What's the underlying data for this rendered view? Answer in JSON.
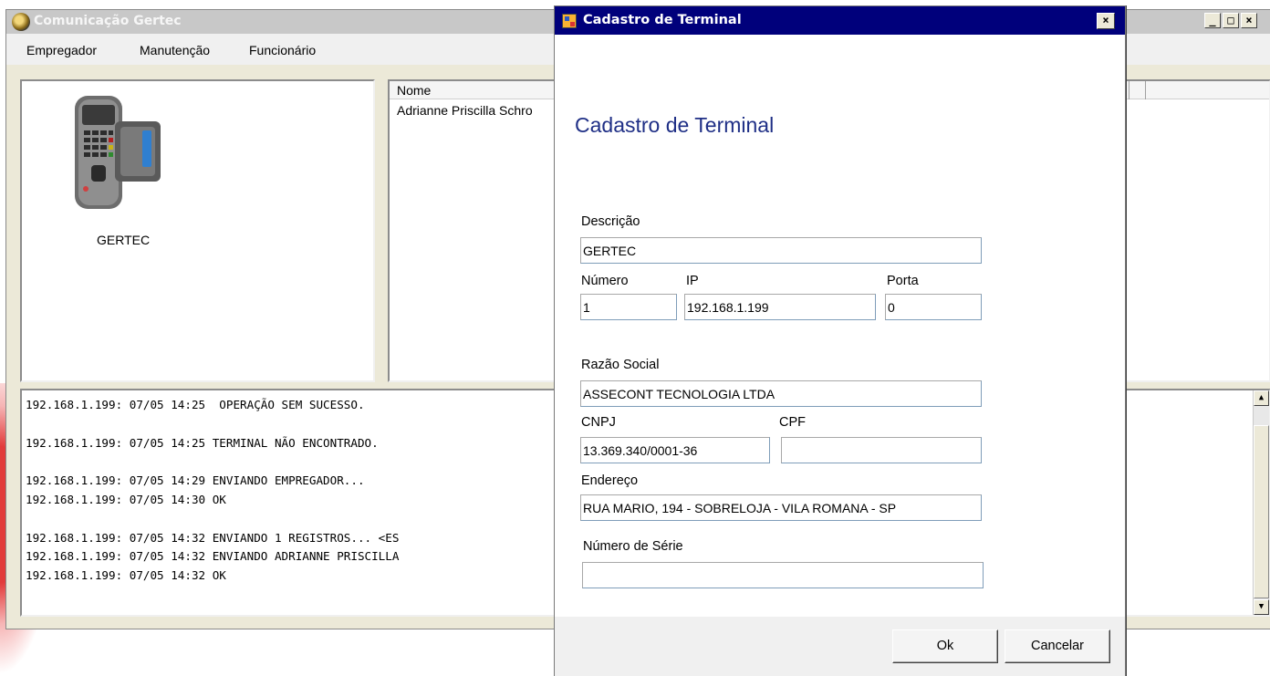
{
  "main_window": {
    "title": "Comunicação Gertec",
    "controls": {
      "minimize": "_",
      "maximize": "□",
      "close": "×"
    },
    "menu": [
      "Empregador",
      "Manutenção",
      "Funcionário"
    ],
    "terminal": {
      "label": "GERTEC"
    },
    "list": {
      "columns": [
        "Nome"
      ],
      "rows": [
        "Adrianne Priscilla Schro"
      ]
    },
    "log_lines": [
      "192.168.1.199: 07/05 14:25  OPERAÇÃO SEM SUCESSO.",
      "",
      "192.168.1.199: 07/05 14:25 TERMINAL NÃO ENCONTRADO.",
      "",
      "192.168.1.199: 07/05 14:29 ENVIANDO EMPREGADOR...",
      "192.168.1.199: 07/05 14:30 OK",
      "",
      "192.168.1.199: 07/05 14:32 ENVIANDO 1 REGISTROS... <ES",
      "192.168.1.199: 07/05 14:32 ENVIANDO ADRIANNE PRISCILLA",
      "192.168.1.199: 07/05 14:32 OK"
    ]
  },
  "dialog": {
    "title": "Cadastro de Terminal",
    "close": "×",
    "heading": "Cadastro de Terminal",
    "fields": {
      "descricao": {
        "label": "Descrição",
        "value": "GERTEC"
      },
      "numero": {
        "label": "Número",
        "value": "1"
      },
      "ip": {
        "label": "IP",
        "value": "192.168.1.199"
      },
      "porta": {
        "label": "Porta",
        "value": "0"
      },
      "razao_social": {
        "label": "Razão Social",
        "value": "ASSECONT TECNOLOGIA LTDA"
      },
      "cnpj": {
        "label": "CNPJ",
        "value": "13.369.340/0001-36"
      },
      "cpf": {
        "label": "CPF",
        "value": ""
      },
      "endereco": {
        "label": "Endereço",
        "value": "RUA MARIO, 194 - SOBRELOJA - VILA ROMANA - SP"
      },
      "numero_serie": {
        "label": "Número de Série",
        "value": ""
      }
    },
    "buttons": {
      "ok": "Ok",
      "cancel": "Cancelar"
    }
  },
  "colors": {
    "dialog_titlebar": "#00007b",
    "heading_text": "#1f2f86",
    "inactive_titlebar": "#c8c8c8"
  }
}
